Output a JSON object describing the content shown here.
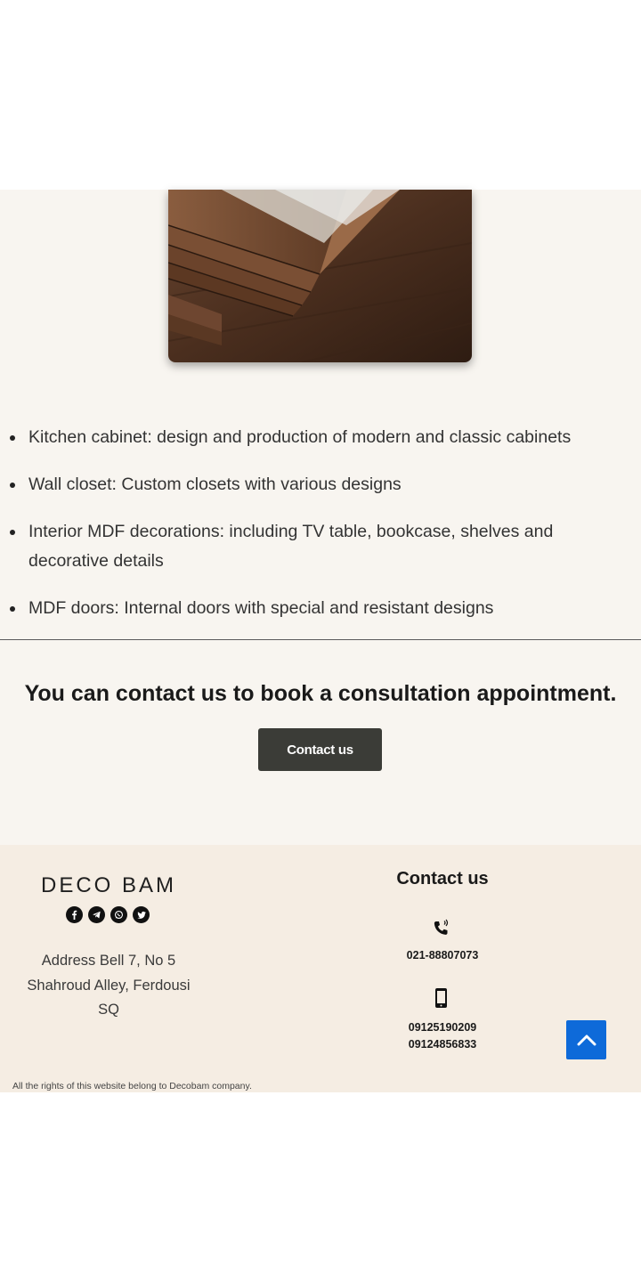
{
  "hero": {
    "image_alt": ""
  },
  "services": [
    "Kitchen cabinet: design and production of modern and classic cabinets",
    "Wall closet: Custom closets with various designs",
    "Interior MDF decorations: including TV table, bookcase, shelves and decorative details",
    "MDF doors: Internal doors with special and resistant designs"
  ],
  "cta": {
    "title": "You can contact us to book a consultation appointment.",
    "button_label": "Contact us"
  },
  "footer": {
    "logo_text": "DECO BAM",
    "social_icons": [
      "facebook-icon",
      "telegram-icon",
      "whatsapp-icon",
      "twitter-icon"
    ],
    "address": "Address Bell 7, No 5 Shahroud Alley, Ferdousi SQ",
    "contact_heading": "Contact us",
    "landline": "021-88807073",
    "mobile_1": "09125190209",
    "mobile_2": "09124856833",
    "copyright": "All the rights of this website belong to Decobam company."
  },
  "colors": {
    "section_bg": "#f8f5f0",
    "footer_bg": "#f5ede3",
    "button_bg": "#3b3c37",
    "scroll_top_bg": "#0e6ad9"
  }
}
